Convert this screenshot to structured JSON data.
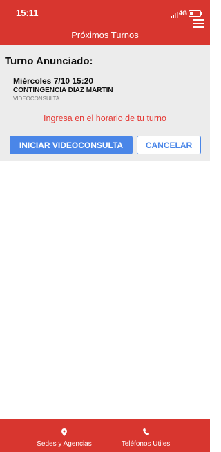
{
  "status_bar": {
    "time": "15:11",
    "network": "4G"
  },
  "header": {
    "title": "Próximos Turnos"
  },
  "card": {
    "heading": "Turno Anunciado:",
    "date": "Miércoles 7/10 15:20",
    "name": "CONTINGENCIA DIAZ MARTIN",
    "type": "VIDEOCONSULTA",
    "notice": "Ingresa en el horario de tu turno",
    "start_button": "INICIAR VIDEOCONSULTA",
    "cancel_button": "CANCELAR"
  },
  "bottom_nav": {
    "items": [
      {
        "label": "Sedes y Agencias",
        "icon": "location-pin-icon"
      },
      {
        "label": "Teléfonos Útiles",
        "icon": "phone-icon"
      }
    ]
  },
  "colors": {
    "brand_red": "#d8362f",
    "accent_blue": "#4a86e8",
    "notice_red": "#e53935",
    "card_bg": "#ececec"
  }
}
